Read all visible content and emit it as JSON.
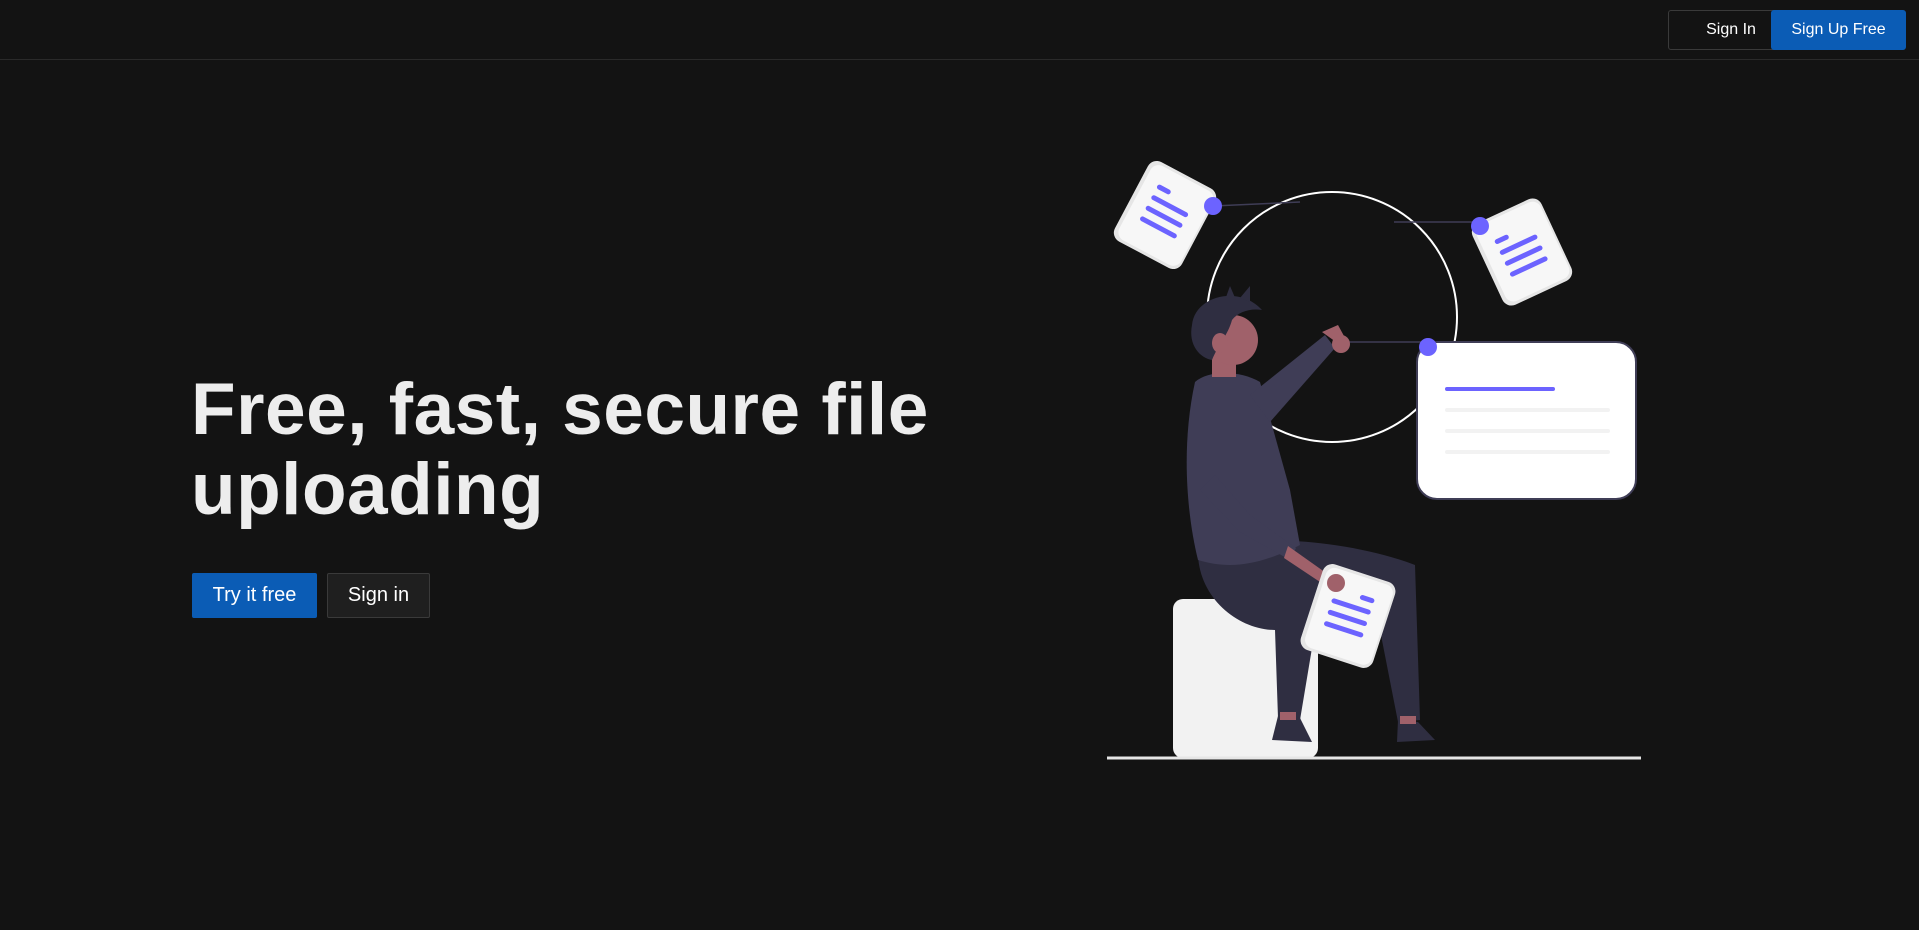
{
  "nav": {
    "sign_in_label": "Sign In",
    "sign_up_label": "Sign Up Free"
  },
  "hero": {
    "title": "Free, fast, secure file uploading",
    "try_label": "Try it free",
    "sign_in_label": "Sign in"
  },
  "colors": {
    "background": "#131313",
    "primary_button": "#0b5cb5",
    "accent": "#6c63ff",
    "illustration_dark": "#3f3d56",
    "skin": "#a0616a",
    "paper": "#f2f2f2"
  }
}
